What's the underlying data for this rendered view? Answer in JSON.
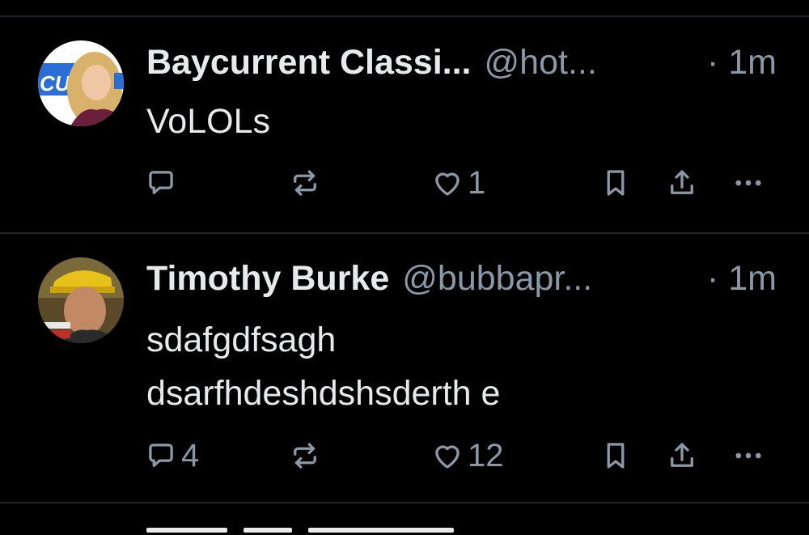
{
  "posts": [
    {
      "display_name": "Baycurrent Classi...",
      "handle": "@hot...",
      "time": "· 1m",
      "text_lines": [
        "VoLOLs"
      ],
      "reply_count": "",
      "repost_count": "",
      "like_count": "1",
      "avatar_icon": "avatar-photo"
    },
    {
      "display_name": "Timothy Burke",
      "handle": "@bubbapr...",
      "time": "· 1m",
      "text_lines": [
        "sdafgdfsagh",
        "dsarfhdeshdshsderth e"
      ],
      "reply_count": "4",
      "repost_count": "",
      "like_count": "12",
      "avatar_icon": "avatar-photo"
    }
  ],
  "colors": {
    "background": "#000000",
    "text": "#e7e9ea",
    "secondary": "#8b98a5",
    "divider": "#1f2328"
  }
}
